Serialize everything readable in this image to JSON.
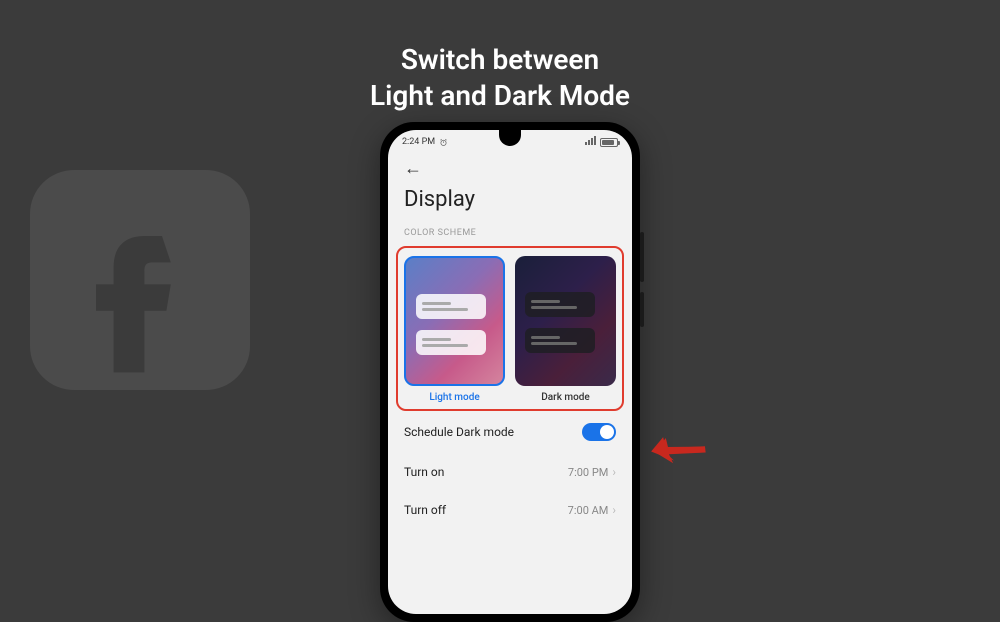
{
  "title": {
    "line1": "Switch between",
    "line2": "Light and Dark Mode"
  },
  "statusbar": {
    "time": "2:24 PM"
  },
  "page": {
    "title": "Display",
    "section": "COLOR SCHEME",
    "light_label": "Light mode",
    "dark_label": "Dark mode",
    "schedule_label": "Schedule Dark mode",
    "turn_on_label": "Turn on",
    "turn_on_time": "7:00 PM",
    "turn_off_label": "Turn off",
    "turn_off_time": "7:00 AM"
  },
  "colors": {
    "accent": "#1a73e8",
    "highlight": "#e03c2e",
    "arrow": "#c8281e"
  }
}
